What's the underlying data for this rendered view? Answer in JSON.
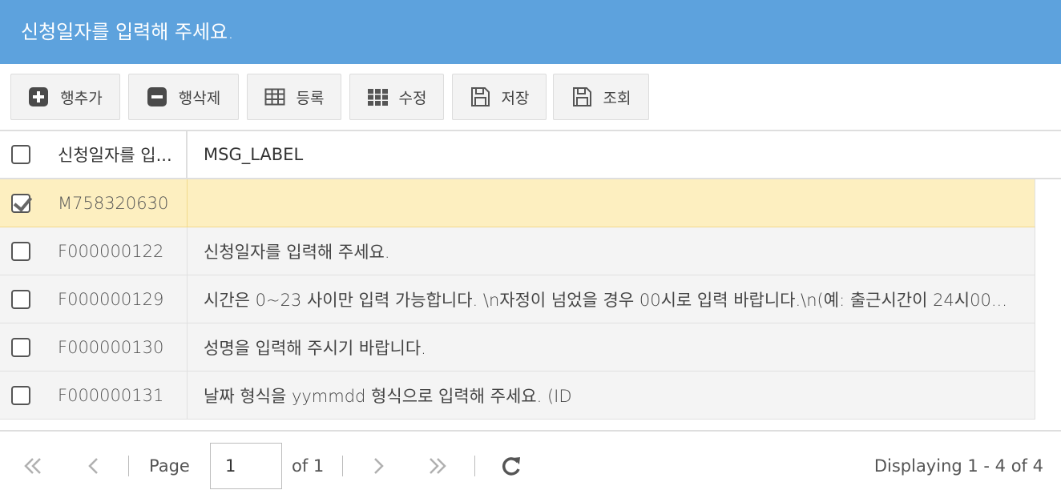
{
  "window": {
    "title": "신청일자를 입력해 주세요."
  },
  "toolbar": {
    "add_row": "행추가",
    "delete_row": "행삭제",
    "register": "등록",
    "edit": "수정",
    "save": "저장",
    "search": "조회"
  },
  "grid": {
    "columns": [
      "신청일자를 입...",
      "MSG_LABEL"
    ],
    "rows": [
      {
        "id": "M758320630",
        "msg": "",
        "checked": true
      },
      {
        "id": "F000000122",
        "msg": "신청일자를 입력해 주세요.",
        "checked": false
      },
      {
        "id": "F000000129",
        "msg": "시간은 0~23 사이만 입력 가능합니다. \\n자정이 넘었을 경우 00시로 입력 바랍니다.\\n(예: 출근시간이 24시00...",
        "checked": false
      },
      {
        "id": "F000000130",
        "msg": "성명을 입력해 주시기 바랍니다.",
        "checked": false
      },
      {
        "id": "F000000131",
        "msg": "날짜 형식을 yymmdd 형식으로 입력해 주세요. (ID",
        "checked": false
      }
    ]
  },
  "pager": {
    "page_label": "Page",
    "page_value": "1",
    "of_label": "of 1",
    "displaying": "Displaying 1 - 4 of 4"
  },
  "colors": {
    "title_bar": "#5da2dd",
    "selected_row": "#fdefc0"
  }
}
